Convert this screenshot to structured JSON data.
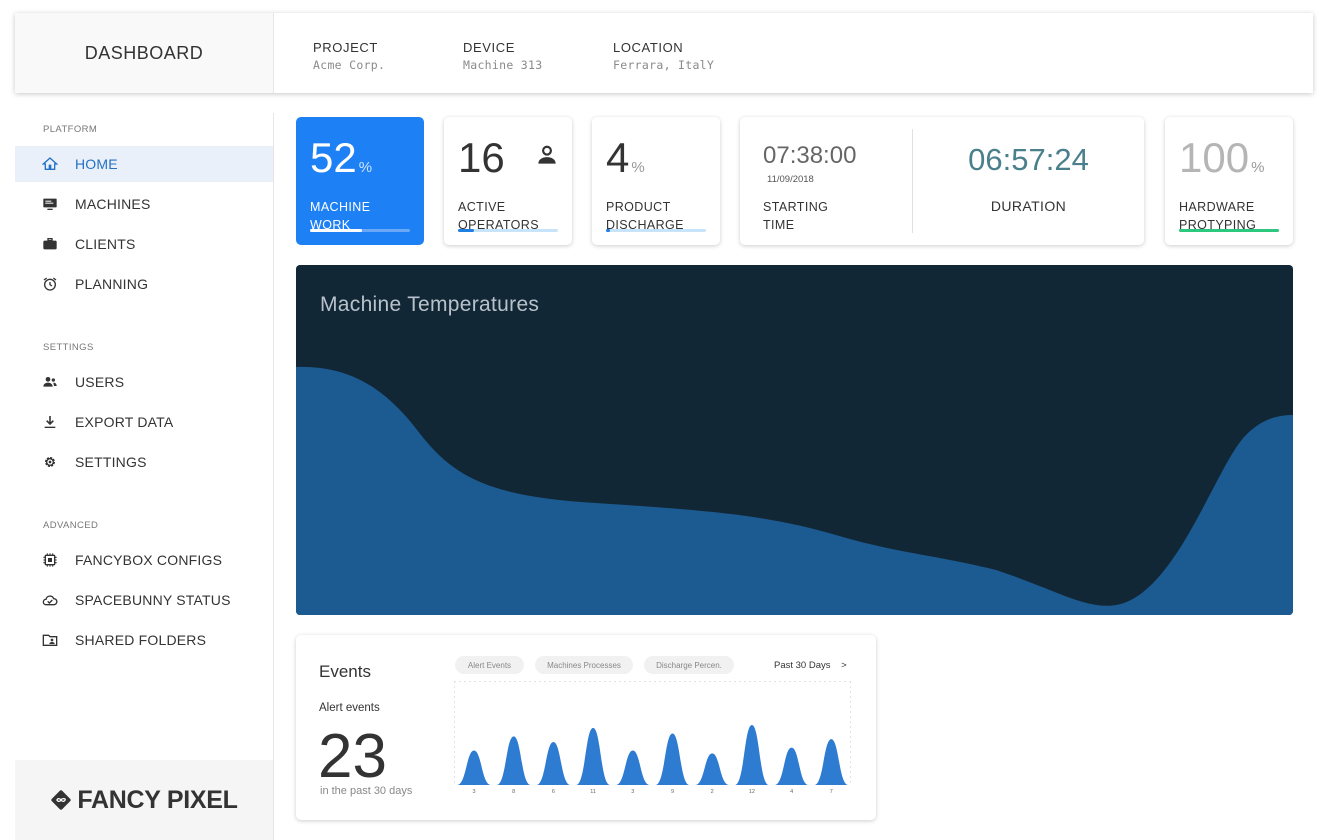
{
  "header": {
    "title": "DASHBOARD",
    "meta": [
      {
        "key": "PROJECT",
        "value": "Acme Corp."
      },
      {
        "key": "DEVICE",
        "value": "Machine 313"
      },
      {
        "key": "LOCATION",
        "value": "Ferrara, ItalY"
      }
    ]
  },
  "sidebar": {
    "sections": [
      {
        "title": "PLATFORM",
        "items": [
          {
            "label": "HOME",
            "icon": "home-icon",
            "active": true
          },
          {
            "label": "MACHINES",
            "icon": "monitor-icon"
          },
          {
            "label": "CLIENTS",
            "icon": "briefcase-icon"
          },
          {
            "label": "PLANNING",
            "icon": "alarm-clock-icon"
          }
        ]
      },
      {
        "title": "SETTINGS",
        "items": [
          {
            "label": "USERS",
            "icon": "users-icon"
          },
          {
            "label": "EXPORT DATA",
            "icon": "download-icon"
          },
          {
            "label": "SETTINGS",
            "icon": "gear-icon"
          }
        ]
      },
      {
        "title": "ADVANCED",
        "items": [
          {
            "label": "FANCYBOX CONFIGS",
            "icon": "chip-icon"
          },
          {
            "label": "SPACEBUNNY STATUS",
            "icon": "cloud-check-icon"
          },
          {
            "label": "SHARED FOLDERS",
            "icon": "shared-folder-icon"
          }
        ]
      }
    ],
    "logo": "FANCY PIXEL"
  },
  "stats": {
    "machine_work": {
      "value": "52",
      "unit": "%",
      "label_line1": "MACHINE",
      "label_line2": "WORK",
      "progress": 0.52
    },
    "active_operators": {
      "value": "16",
      "label_line1": "ACTIVE",
      "label_line2": "OPERATORS",
      "icon": "person-icon",
      "progress": 0.16
    },
    "product_discharge": {
      "value": "4",
      "unit": "%",
      "label_line1": "PRODUCT",
      "label_line2": "DISCHARGE",
      "progress": 0.04
    },
    "timing": {
      "starting_time": "07:38:00",
      "date": "11/09/2018",
      "starting_label_line1": "STARTING",
      "starting_label_line2": "TIME",
      "duration": "06:57:24",
      "duration_label": "DURATION"
    },
    "hardware": {
      "value": "100",
      "unit": "%",
      "label_line1": "HARDWARE",
      "label_line2": "PROTYPING",
      "progress": 1.0
    }
  },
  "temperatures": {
    "title": "Machine Temperatures",
    "colors": {
      "background": "#122736",
      "area": "#1c5b92"
    }
  },
  "events": {
    "title": "Events",
    "subtitle": "Alert events",
    "count": "23",
    "caption": "in the past 30 days",
    "filters": [
      "Alert Events",
      "Machines Processes",
      "Discharge Percen."
    ],
    "range": "Past 30 Days",
    "range_arrow": ">",
    "accent": "#2e7bd2",
    "chart_data": {
      "type": "area",
      "x": [
        "3",
        "8",
        "6",
        "11",
        "3",
        "9",
        "2",
        "12",
        "4",
        "7"
      ],
      "values": [
        3,
        8,
        6,
        11,
        3,
        9,
        2,
        12,
        4,
        7
      ]
    }
  }
}
